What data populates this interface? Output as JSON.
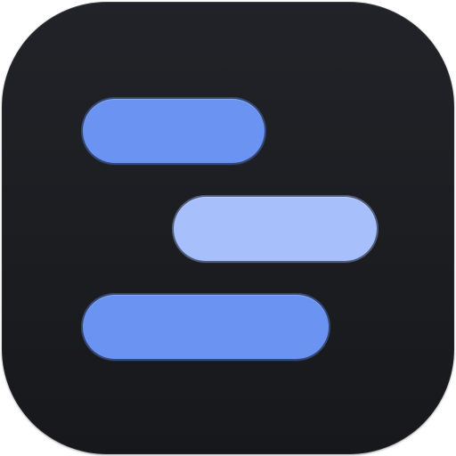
{
  "icon": {
    "background_color": "#1c1d21",
    "bars": [
      {
        "name": "bar-top",
        "color": "#6b93f2"
      },
      {
        "name": "bar-middle",
        "color": "#a7bffb"
      },
      {
        "name": "bar-bottom",
        "color": "#6b93f2"
      }
    ]
  }
}
